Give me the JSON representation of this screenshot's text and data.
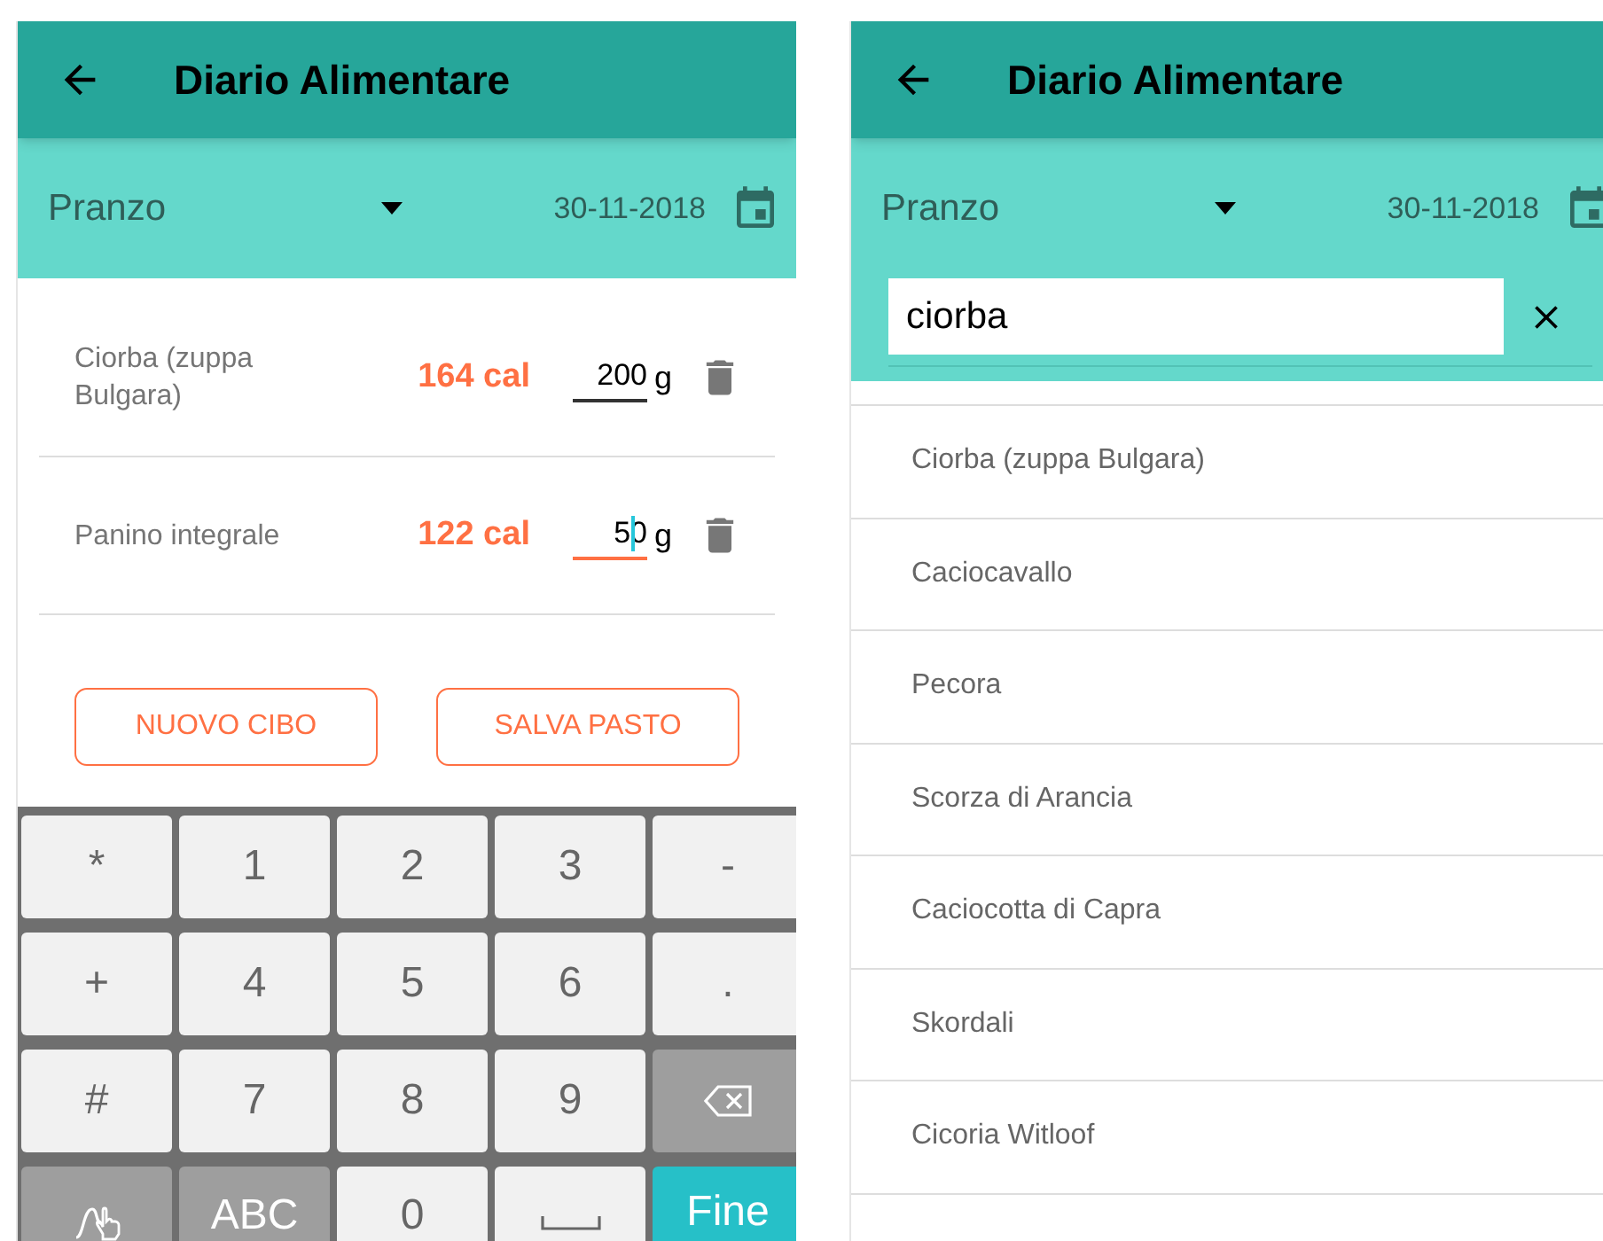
{
  "screens": [
    {
      "kind": "diary",
      "title": "Diario Alimentare",
      "meal": "Pranzo",
      "date": "30-11-2018",
      "entries": [
        {
          "name": "Ciorba (zuppa Bulgara)",
          "calories": "164 cal",
          "quantity": "200",
          "unit": "g",
          "focused": false
        },
        {
          "name": "Panino integrale",
          "calories": "122 cal",
          "quantity": "50",
          "unit": "g",
          "focused": true
        }
      ],
      "buttons": [
        "NUOVO CIBO",
        "SALVA PASTO"
      ],
      "keyboard": [
        {
          "kind": "char",
          "label": "*"
        },
        {
          "kind": "char",
          "label": "1"
        },
        {
          "kind": "char",
          "label": "2"
        },
        {
          "kind": "char",
          "label": "3"
        },
        {
          "kind": "char",
          "label": "-"
        },
        {
          "kind": "char",
          "label": "+"
        },
        {
          "kind": "char",
          "label": "4"
        },
        {
          "kind": "char",
          "label": "5"
        },
        {
          "kind": "char",
          "label": "6"
        },
        {
          "kind": "char",
          "label": "."
        },
        {
          "kind": "char",
          "label": "#"
        },
        {
          "kind": "char",
          "label": "7"
        },
        {
          "kind": "char",
          "label": "8"
        },
        {
          "kind": "char",
          "label": "9"
        },
        {
          "kind": "backspace"
        },
        {
          "kind": "gesture"
        },
        {
          "kind": "mode",
          "label": "ABC"
        },
        {
          "kind": "char",
          "label": "0"
        },
        {
          "kind": "space"
        },
        {
          "kind": "done",
          "label": "Fine"
        }
      ]
    },
    {
      "kind": "search",
      "title": "Diario Alimentare",
      "meal": "Pranzo",
      "date": "30-11-2018",
      "query": "ciorba",
      "results": [
        "Ciorba (zuppa Bulgara)",
        "Caciocavallo",
        "Pecora",
        "Scorza di Arancia",
        "Caciocotta di Capra",
        "Skordali",
        "Cicoria Witloof"
      ]
    }
  ]
}
